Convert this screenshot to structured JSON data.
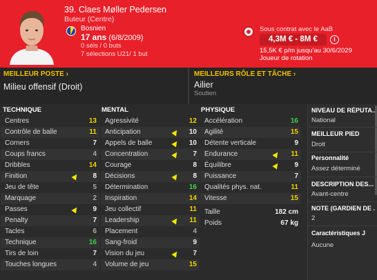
{
  "player": {
    "name": "39. Claes Møller Pedersen",
    "role": "Buteur (Centre)",
    "nationality": "Bosnien",
    "age_num": "17 ans",
    "age_date": "(6/8/2009)",
    "caps": "0 séls / 0 buts",
    "u21": "7 sélections U21/ 1 but"
  },
  "contract": {
    "label": "Sous contrat avec le AaB",
    "value": "4,3M € - 8M €",
    "wage": "15,5K € p/m jusqu'au 30/6/2029",
    "status": "Joueur de rotation"
  },
  "position": {
    "best_label": "MEILLEUR POSTE",
    "best_value": "Milieu offensif (Droit)",
    "role_label": "MEILLEURS RÔLE ET TÂCHE",
    "role_value": "Ailier",
    "role_duty": "Soutien"
  },
  "technique": {
    "title": "TECHNIQUE",
    "rows": [
      {
        "label": "Centres",
        "value": "13",
        "color": "yellow"
      },
      {
        "label": "Contrôle de balle",
        "value": "11",
        "color": "yellow"
      },
      {
        "label": "Corners",
        "value": "7",
        "color": "white"
      },
      {
        "label": "Coups francs",
        "value": "4",
        "color": "grey"
      },
      {
        "label": "Dribbles",
        "value": "14",
        "color": "yellow"
      },
      {
        "label": "Finition",
        "value": "8",
        "color": "white",
        "arrow": true
      },
      {
        "label": "Jeu de tête",
        "value": "5",
        "color": "grey"
      },
      {
        "label": "Marquage",
        "value": "2",
        "color": "grey"
      },
      {
        "label": "Passes",
        "value": "9",
        "color": "white",
        "arrow": true
      },
      {
        "label": "Penalty",
        "value": "7",
        "color": "white"
      },
      {
        "label": "Tacles",
        "value": "6",
        "color": "grey"
      },
      {
        "label": "Technique",
        "value": "16",
        "color": "green"
      },
      {
        "label": "Tirs de loin",
        "value": "7",
        "color": "white"
      },
      {
        "label": "Touches longues",
        "value": "4",
        "color": "grey"
      }
    ]
  },
  "mental": {
    "title": "MENTAL",
    "rows": [
      {
        "label": "Agressivité",
        "value": "12",
        "color": "yellow"
      },
      {
        "label": "Anticipation",
        "value": "10",
        "color": "white",
        "arrow": true
      },
      {
        "label": "Appels de balle",
        "value": "10",
        "color": "white",
        "arrow": true
      },
      {
        "label": "Concentration",
        "value": "7",
        "color": "white",
        "arrow": true
      },
      {
        "label": "Courage",
        "value": "8",
        "color": "white"
      },
      {
        "label": "Décisions",
        "value": "8",
        "color": "white",
        "arrow": true
      },
      {
        "label": "Détermination",
        "value": "16",
        "color": "green"
      },
      {
        "label": "Inspiration",
        "value": "14",
        "color": "yellow"
      },
      {
        "label": "Jeu collectif",
        "value": "11",
        "color": "yellow"
      },
      {
        "label": "Leadership",
        "value": "11",
        "color": "yellow",
        "arrow": true
      },
      {
        "label": "Placement",
        "value": "4",
        "color": "grey"
      },
      {
        "label": "Sang-froid",
        "value": "9",
        "color": "white"
      },
      {
        "label": "Vision du jeu",
        "value": "7",
        "color": "white",
        "arrow": true
      },
      {
        "label": "Volume de jeu",
        "value": "15",
        "color": "yellow"
      }
    ]
  },
  "physique": {
    "title": "PHYSIQUE",
    "rows": [
      {
        "label": "Accélération",
        "value": "16",
        "color": "green"
      },
      {
        "label": "Agilité",
        "value": "15",
        "color": "yellow"
      },
      {
        "label": "Détente verticale",
        "value": "9",
        "color": "white"
      },
      {
        "label": "Endurance",
        "value": "11",
        "color": "yellow",
        "arrow": true
      },
      {
        "label": "Équilibre",
        "value": "9",
        "color": "white",
        "arrow": true
      },
      {
        "label": "Puissance",
        "value": "7",
        "color": "white"
      },
      {
        "label": "Qualités phys. nat.",
        "value": "11",
        "color": "yellow"
      },
      {
        "label": "Vitesse",
        "value": "15",
        "color": "yellow"
      }
    ],
    "height_label": "Taille",
    "height_value": "182 cm",
    "weight_label": "Poids",
    "weight_value": "67 kg"
  },
  "side": {
    "rep_title": "NIVEAU DE RÉPUTA...",
    "rep_value": "National",
    "foot_title": "MEILLEUR PIED",
    "foot_value": "Droit",
    "pers_title": "Personnalité",
    "pers_value": "Assez déterminé",
    "desc_title": "DESCRIPTION DES...",
    "desc_value": "Avant-centre",
    "note_title": "NOTE (GARDIEN DE ...",
    "note_value": "2",
    "traits_title": "Caractéristiques J",
    "traits_value": "Aucune"
  },
  "colors": {
    "header": "#e8202a",
    "accent": "#f2c200",
    "green": "#3fcf4a",
    "yellow": "#f2d500"
  }
}
